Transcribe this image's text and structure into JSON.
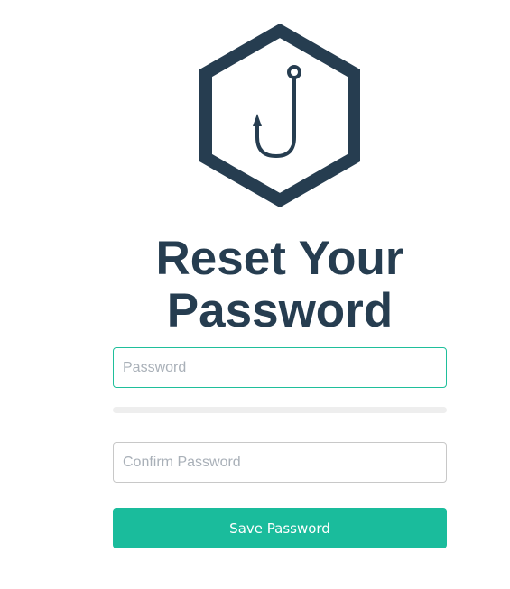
{
  "logo": {
    "icon": "fishing-hook-hexagon-icon",
    "color": "#263d50"
  },
  "page": {
    "title_line1": "Reset Your",
    "title_line2": "Password"
  },
  "form": {
    "password": {
      "placeholder": "Password",
      "value": ""
    },
    "strength": {
      "level": 0
    },
    "confirm": {
      "placeholder": "Confirm Password",
      "value": ""
    },
    "save_label": "Save Password"
  },
  "colors": {
    "accent": "#1abc9c",
    "title": "#263d50",
    "meter_track": "#eeeeee"
  }
}
